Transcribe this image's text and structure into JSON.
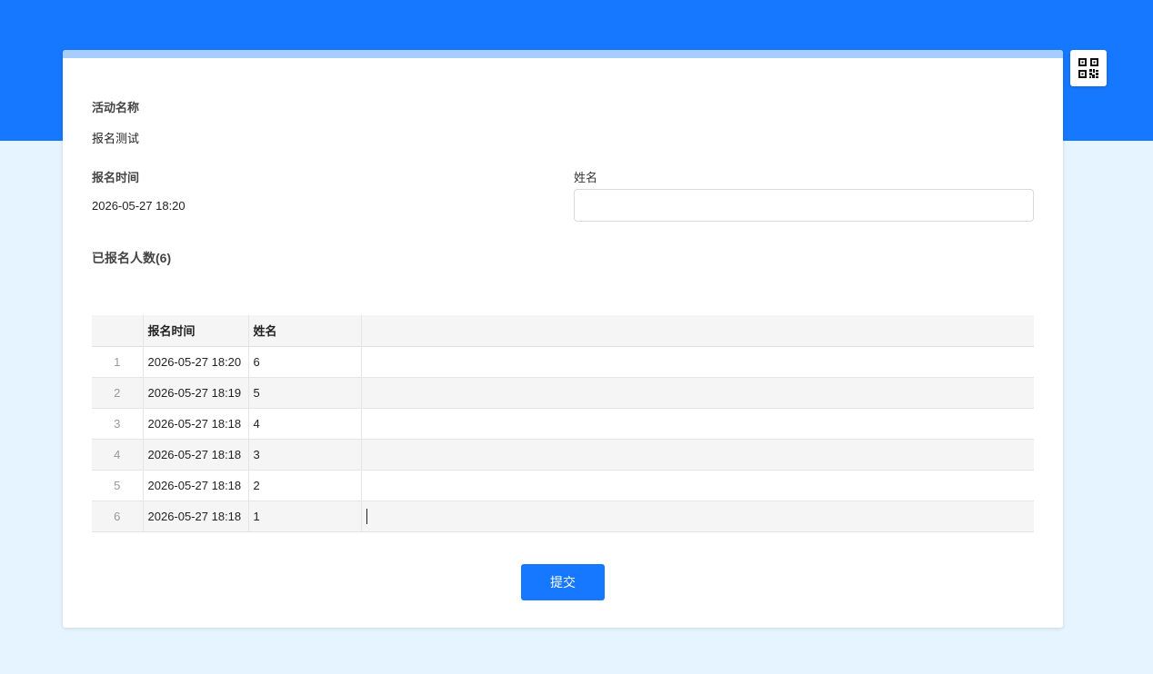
{
  "colors": {
    "primary": "#1677ff",
    "background": "#e6f4ff",
    "card_accent": "#a6cdfb"
  },
  "qr_button": {
    "icon": "qr-code-icon"
  },
  "form": {
    "activity_label": "活动名称",
    "activity_value": "报名测试",
    "time_label": "报名时间",
    "time_value": "2026-05-27 18:20",
    "name_label": "姓名",
    "name_value": "",
    "name_placeholder": ""
  },
  "registrations": {
    "title": "已报名人数(6)",
    "columns": [
      "",
      "报名时间",
      "姓名",
      ""
    ],
    "rows": [
      {
        "index": "1",
        "time": "2026-05-27 18:20",
        "name": "6"
      },
      {
        "index": "2",
        "time": "2026-05-27 18:19",
        "name": "5"
      },
      {
        "index": "3",
        "time": "2026-05-27 18:18",
        "name": "4"
      },
      {
        "index": "4",
        "time": "2026-05-27 18:18",
        "name": "3"
      },
      {
        "index": "5",
        "time": "2026-05-27 18:18",
        "name": "2"
      },
      {
        "index": "6",
        "time": "2026-05-27 18:18",
        "name": "1"
      }
    ]
  },
  "submit_label": "提交"
}
